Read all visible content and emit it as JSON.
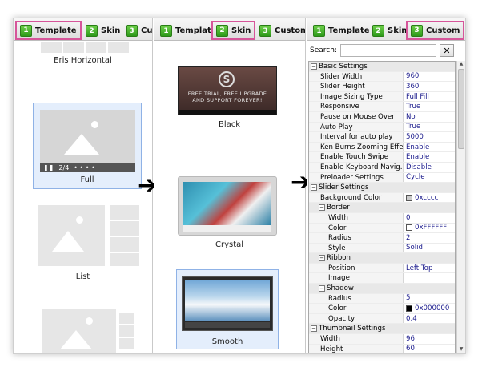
{
  "panel1": {
    "tabs": [
      {
        "num": "1",
        "label": "Template",
        "active": true
      },
      {
        "num": "2",
        "label": "Skin",
        "active": false
      },
      {
        "num": "3",
        "label": "Cu",
        "active": false
      }
    ],
    "templates": [
      "Eris Horizontal",
      "Full",
      "List"
    ],
    "player_counter": "2/4"
  },
  "panel2": {
    "tabs": [
      {
        "num": "1",
        "label": "Template",
        "active": false
      },
      {
        "num": "2",
        "label": "Skin",
        "active": true
      },
      {
        "num": "3",
        "label": "Custom",
        "active": false
      }
    ],
    "skins": [
      "Black",
      "Crystal",
      "Smooth"
    ],
    "trial_text": "FREE TRIAL, FREE UPGRADE AND SUPPORT FOREVER!"
  },
  "panel3": {
    "tabs": [
      {
        "num": "1",
        "label": "Template",
        "active": false
      },
      {
        "num": "2",
        "label": "Skin",
        "active": false
      },
      {
        "num": "3",
        "label": "Custom",
        "active": true
      }
    ],
    "search_label": "Search:",
    "search_value": "",
    "clear_glyph": "✕",
    "rows": [
      {
        "type": "cat",
        "level": 0,
        "label": "Basic Settings"
      },
      {
        "type": "prop",
        "level": 1,
        "label": "Slider Width",
        "value": "960"
      },
      {
        "type": "prop",
        "level": 1,
        "label": "Slider Height",
        "value": "360"
      },
      {
        "type": "prop",
        "level": 1,
        "label": "Image Sizing Type",
        "value": "Full Fill"
      },
      {
        "type": "prop",
        "level": 1,
        "label": "Responsive",
        "value": "True"
      },
      {
        "type": "prop",
        "level": 1,
        "label": "Pause on Mouse Over",
        "value": "No"
      },
      {
        "type": "prop",
        "level": 1,
        "label": "Auto Play",
        "value": "True"
      },
      {
        "type": "prop",
        "level": 1,
        "label": "Interval for auto play",
        "value": "5000"
      },
      {
        "type": "prop",
        "level": 1,
        "label": "Ken Burns Zooming Effect",
        "value": "Enable"
      },
      {
        "type": "prop",
        "level": 1,
        "label": "Enable Touch Swipe",
        "value": "Enable"
      },
      {
        "type": "prop",
        "level": 1,
        "label": "Enable Keyboard Navig...",
        "value": "Disable"
      },
      {
        "type": "prop",
        "level": 1,
        "label": "Preloader Settings",
        "value": "Cycle"
      },
      {
        "type": "cat",
        "level": 0,
        "label": "Slider Settings"
      },
      {
        "type": "prop",
        "level": 1,
        "label": "Background Color",
        "value": "0xcccc",
        "swatch": "#cccccc"
      },
      {
        "type": "cat",
        "level": 1,
        "label": "Border"
      },
      {
        "type": "prop",
        "level": 2,
        "label": "Width",
        "value": "0"
      },
      {
        "type": "prop",
        "level": 2,
        "label": "Color",
        "value": "0xFFFFFF",
        "swatch": "#ffffff"
      },
      {
        "type": "prop",
        "level": 2,
        "label": "Radius",
        "value": "2"
      },
      {
        "type": "prop",
        "level": 2,
        "label": "Style",
        "value": "Solid"
      },
      {
        "type": "cat",
        "level": 1,
        "label": "Ribbon"
      },
      {
        "type": "prop",
        "level": 2,
        "label": "Position",
        "value": "Left Top"
      },
      {
        "type": "prop",
        "level": 2,
        "label": "Image",
        "value": ""
      },
      {
        "type": "cat",
        "level": 1,
        "label": "Shadow"
      },
      {
        "type": "prop",
        "level": 2,
        "label": "Radius",
        "value": "5"
      },
      {
        "type": "prop",
        "level": 2,
        "label": "Color",
        "value": "0x000000",
        "swatch": "#000000"
      },
      {
        "type": "prop",
        "level": 2,
        "label": "Opacity",
        "value": "0.4"
      },
      {
        "type": "cat",
        "level": 0,
        "label": "Thumbnail Settings"
      },
      {
        "type": "prop",
        "level": 1,
        "label": "Width",
        "value": "96"
      },
      {
        "type": "prop",
        "level": 1,
        "label": "Height",
        "value": "60"
      }
    ]
  },
  "colors": {
    "tab_highlight": "#d6559a",
    "tab_number": "#3aa620",
    "selection": "#e4eefc"
  }
}
